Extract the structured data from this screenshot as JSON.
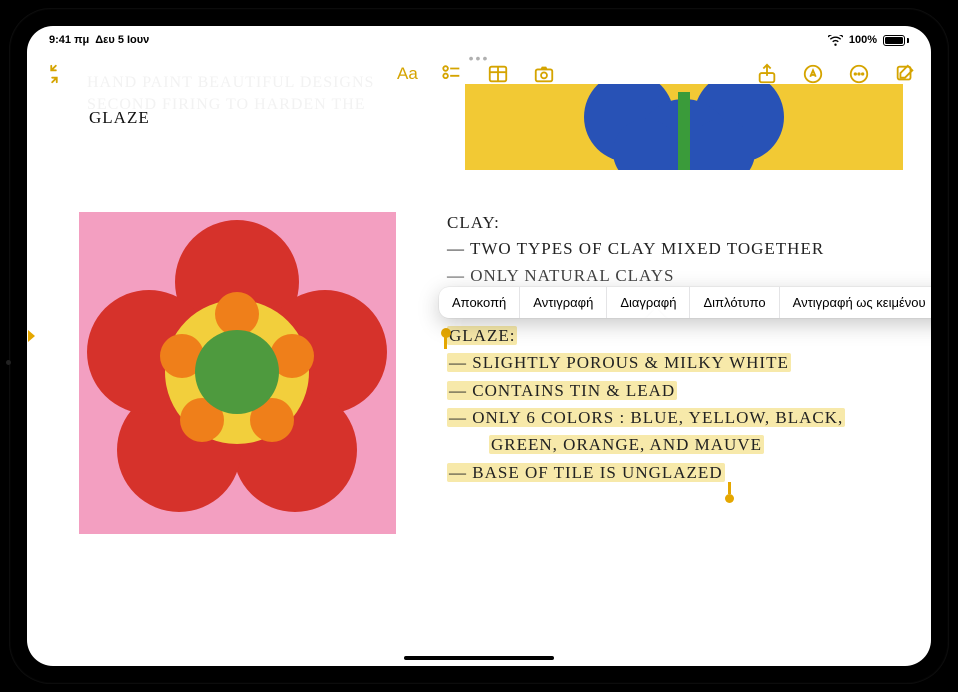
{
  "status_bar": {
    "time": "9:41 πμ",
    "date": "Δευ 5 Ιουν",
    "battery_percent": "100%"
  },
  "note": {
    "faded_line1": "HAND PAINT BEAUTIFUL DESIGNS",
    "faded_line2": "SECOND FIRING TO HARDEN THE",
    "glaze_label": "GLAZE",
    "clay_heading": "CLAY:",
    "clay_line1": "— TWO TYPES OF CLAY MIXED TOGETHER",
    "clay_line2": "— ONLY NATURAL CLAYS",
    "glaze_heading": "GLAZE:",
    "glaze_l1": "— SLIGHTLY POROUS & MILKY WHITE",
    "glaze_l2": "— CONTAINS TIN & LEAD",
    "glaze_l3a": "— ONLY 6 COLORS : BLUE, YELLOW, BLACK,",
    "glaze_l3b": "GREEN, ORANGE, AND MAUVE",
    "glaze_l4": "— BASE OF TILE IS UNGLAZED"
  },
  "context_menu": {
    "cut": "Αποκοπή",
    "copy": "Αντιγραφή",
    "delete": "Διαγραφή",
    "duplicate": "Διπλότυπο",
    "copy_as_text": "Αντιγραφή ως κειμένου"
  },
  "colors": {
    "accent": "#d5a400",
    "highlight": "#f7e9aa",
    "top_art_bg": "#f2c934",
    "top_petal": "#2852b6",
    "top_center": "#3a9b3a",
    "pink_bg": "#f39fc1",
    "red_petal": "#d6322b",
    "orange_dot": "#ef7f1a",
    "yellow_ring": "#f2cf3c",
    "green_center": "#4e9a3e"
  }
}
